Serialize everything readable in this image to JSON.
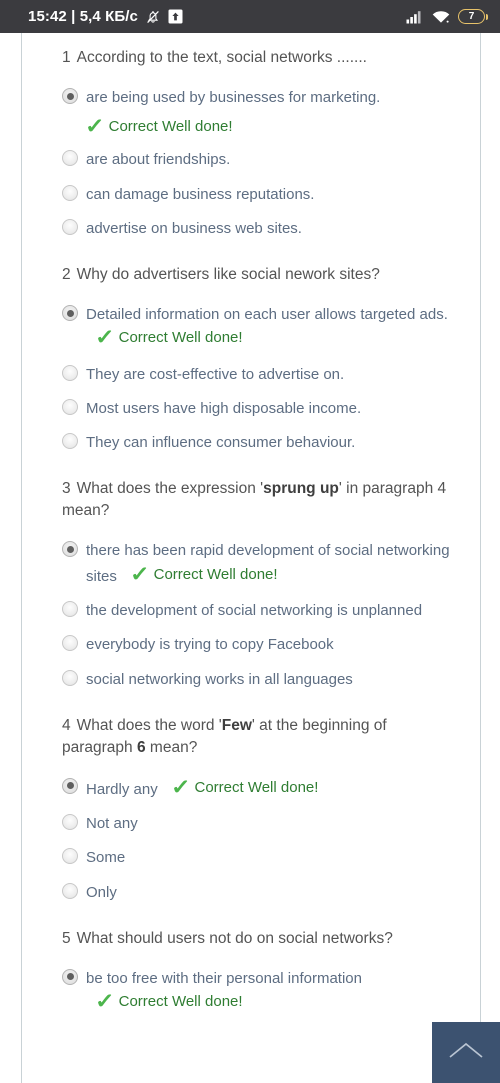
{
  "status_bar": {
    "clock": "15:42 | 5,4 КБ/с",
    "mute_icon": "bell-muted-icon",
    "upload_icon": "upload-arrow-icon",
    "signal_icon": "cellular-signal-icon",
    "wifi_icon": "wifi-icon",
    "battery_level": "7",
    "battery_color": "#e8c36a",
    "background": "#3b3b3f"
  },
  "colors": {
    "question_text": "#545454",
    "option_text": "#5d6d82",
    "correct_text": "#2f7d32",
    "tick": "#4cb54c",
    "scrolltop_bg": "#3c5270",
    "sheet_border": "#c9d2d6"
  },
  "feedback": {
    "tick_glyph": "✓",
    "label": "Correct Well done!"
  },
  "scroll_top_button": {
    "icon": "chevron-up-icon",
    "label": "Scroll to top"
  },
  "quiz": {
    "questions": [
      {
        "number": "1",
        "prompt_html": "According to the text, social networks .......",
        "options": [
          {
            "text": "are being used by businesses for marketing.",
            "selected": true,
            "feedback_position": "below"
          },
          {
            "text": "are about friendships.",
            "selected": false
          },
          {
            "text": "can damage business reputations.",
            "selected": false
          },
          {
            "text": "advertise on business web sites.",
            "selected": false
          }
        ]
      },
      {
        "number": "2",
        "prompt_html": "Why do advertisers like social nework sites?",
        "options": [
          {
            "text": "Detailed information on each user allows targeted ads.",
            "selected": true,
            "feedback_position": "inline"
          },
          {
            "text": "They are cost-effective to advertise on.",
            "selected": false
          },
          {
            "text": "Most users have high disposable income.",
            "selected": false
          },
          {
            "text": "They can influence consumer behaviour.",
            "selected": false
          }
        ]
      },
      {
        "number": "3",
        "prompt_html": "What does the expression '<b>sprung up</b>' in paragraph 4 mean?",
        "options": [
          {
            "text": "there has been rapid development of social networking sites",
            "selected": true,
            "feedback_position": "inline"
          },
          {
            "text": "the development of social networking is unplanned",
            "selected": false
          },
          {
            "text": "everybody is trying to copy Facebook",
            "selected": false
          },
          {
            "text": "social networking works in all languages",
            "selected": false
          }
        ]
      },
      {
        "number": "4",
        "prompt_html": "What does the word '<b>Few</b>' at the beginning of paragraph <b>6</b> mean?",
        "options": [
          {
            "text": "Hardly any",
            "selected": true,
            "feedback_position": "inline"
          },
          {
            "text": "Not any",
            "selected": false
          },
          {
            "text": "Some",
            "selected": false
          },
          {
            "text": "Only",
            "selected": false
          }
        ]
      },
      {
        "number": "5",
        "prompt_html": "What should users not do on social networks?",
        "options": [
          {
            "text": "be too free with their personal information",
            "selected": true,
            "feedback_position": "inline"
          }
        ]
      }
    ]
  }
}
